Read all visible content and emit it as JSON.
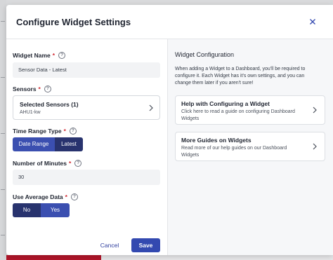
{
  "modal": {
    "title": "Configure Widget Settings"
  },
  "form": {
    "widget_name": {
      "label": "Widget Name",
      "required_mark": "*",
      "value": "Sensor Data - Latest"
    },
    "sensors": {
      "label": "Sensors",
      "required_mark": "*",
      "card_title": "Selected Sensors (1)",
      "card_subtitle": "AHU1-kw"
    },
    "time_range_type": {
      "label": "Time Range Type",
      "required_mark": "*",
      "options": [
        "Date Range",
        "Latest"
      ],
      "selected": "Latest"
    },
    "number_of_minutes": {
      "label": "Number of Minutes",
      "required_mark": "*",
      "value": "30"
    },
    "use_average_data": {
      "label": "Use Average Data",
      "required_mark": "*",
      "options": [
        "No",
        "Yes"
      ],
      "selected": "No"
    },
    "help_glyph": "?"
  },
  "footer": {
    "cancel_label": "Cancel",
    "save_label": "Save"
  },
  "right_panel": {
    "title": "Widget Configuration",
    "description": "When adding a Widget to a Dashboard, you'll be required to configure it. Each Widget has it's own settings, and you can change them later if you aren't sure!",
    "guides": [
      {
        "title": "Help with Configuring a Widget",
        "description": "Click here to read a guide on configuring Dashboard Widgets"
      },
      {
        "title": "More Guides on Widgets",
        "description": "Read more of our help guides on our Dashboard Widgets"
      }
    ]
  },
  "colors": {
    "primary": "#3349b0",
    "segment_selected": "#28336e",
    "segment_unselected": "#3b4fb0",
    "required": "#d0262f",
    "background_bar": "#b2162a"
  }
}
